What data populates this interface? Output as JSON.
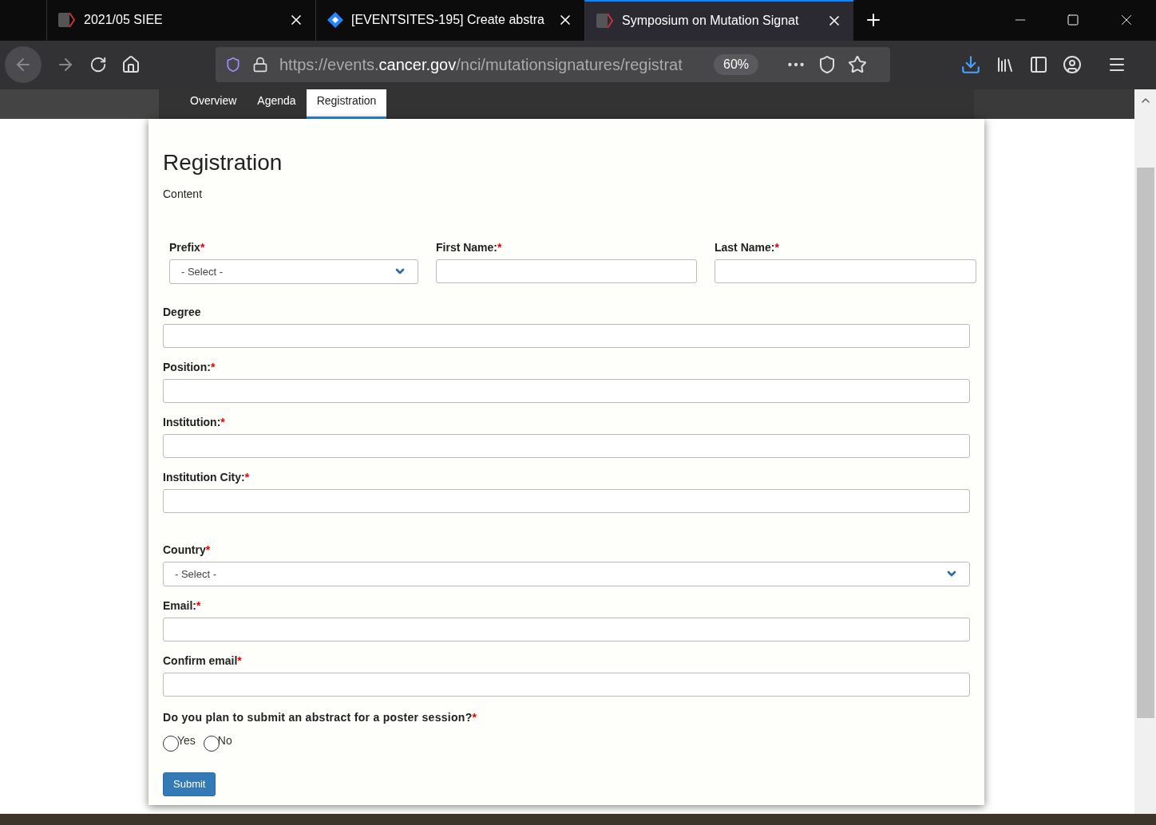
{
  "browser_tabs": [
    {
      "title": "2021/05 SIEE",
      "kind": "site",
      "selected": false
    },
    {
      "title": "[EVENTSITES-195] Create abstra",
      "kind": "jira",
      "selected": false
    },
    {
      "title": "Symposium on Mutation Signat",
      "kind": "site",
      "selected": true
    }
  ],
  "required_mark": "*",
  "url": {
    "prefix": "https://events.",
    "domain": "cancer.gov",
    "path": "/nci/mutationsignatures/registrat"
  },
  "zoom": "60%",
  "nav_tabs": [
    {
      "label": "Overview",
      "selected": false
    },
    {
      "label": "Agenda",
      "selected": false
    },
    {
      "label": "Registration",
      "selected": true
    }
  ],
  "heading": "Registration",
  "content_text": "Content",
  "name_row": [
    {
      "label": "Prefix",
      "required": true,
      "kind": "select",
      "value": "- Select -"
    },
    {
      "label": "First Name:",
      "required": true,
      "kind": "text"
    },
    {
      "label": "Last Name:",
      "required": true,
      "kind": "text"
    }
  ],
  "fields": [
    {
      "label": "Degree",
      "required": false,
      "kind": "text"
    },
    {
      "label": "Position:",
      "required": true,
      "kind": "text"
    },
    {
      "label": "Institution:",
      "required": true,
      "kind": "text"
    },
    {
      "label": "Institution City:",
      "required": true,
      "kind": "text"
    },
    {
      "label": "Country",
      "required": true,
      "kind": "select",
      "value": "- Select -"
    },
    {
      "label": "Email:",
      "required": true,
      "kind": "text"
    },
    {
      "label": "Confirm email",
      "required": true,
      "kind": "text"
    }
  ],
  "question": {
    "label": "Do you plan to submit an abstract for a poster session?",
    "required": true,
    "options": [
      {
        "label": "Yes",
        "selected": false
      },
      {
        "label": "No",
        "selected": false
      }
    ]
  },
  "submit": "Submit"
}
